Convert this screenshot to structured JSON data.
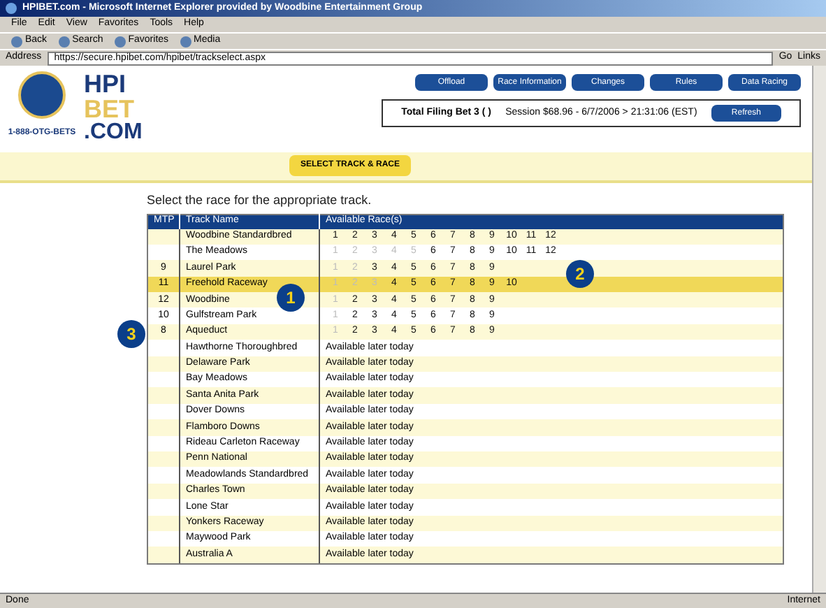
{
  "window": {
    "title": "HPIBET.com - Microsoft Internet Explorer provided by Woodbine Entertainment Group"
  },
  "menu": [
    "File",
    "Edit",
    "View",
    "Favorites",
    "Tools",
    "Help"
  ],
  "toolbar": [
    "Back",
    "Search",
    "Favorites",
    "Media"
  ],
  "address": {
    "label": "Address",
    "value": "https://secure.hpibet.com/hpibet/trackselect.aspx"
  },
  "go": "Go",
  "links": "Links",
  "site": {
    "logo_top": "HPI",
    "logo_mid": "BET",
    "logo_bottom": ".COM",
    "phone": "1-888-OTG-BETS",
    "nav": [
      "Offload",
      "Race Information",
      "Changes",
      "Rules",
      "Data Racing"
    ],
    "info": "Total Filing Bet 3 ( )",
    "session": "Session $68.96 - 6/7/2006 > 21:31:06 (EST)",
    "refresh": "Refresh",
    "tab": "SELECT TRACK & RACE"
  },
  "heading": "Select the race for the appropriate track.",
  "table": {
    "columns": [
      "MTP",
      "Track Name",
      "Available Race(s)"
    ],
    "rows": [
      {
        "kind": "races",
        "mtp": "",
        "track": "Woodbine Standardbred",
        "selected": false,
        "races": [
          {
            "label": "1",
            "enabled": true
          },
          {
            "label": "2",
            "enabled": true
          },
          {
            "label": "3",
            "enabled": true
          },
          {
            "label": "4",
            "enabled": true
          },
          {
            "label": "5",
            "enabled": true
          },
          {
            "label": "6",
            "enabled": true
          },
          {
            "label": "7",
            "enabled": true
          },
          {
            "label": "8",
            "enabled": true
          },
          {
            "label": "9",
            "enabled": true
          },
          {
            "label": "10",
            "enabled": true
          },
          {
            "label": "11",
            "enabled": true
          },
          {
            "label": "12",
            "enabled": true
          }
        ]
      },
      {
        "kind": "races",
        "mtp": "",
        "track": "The Meadows",
        "selected": false,
        "races": [
          {
            "label": "1",
            "enabled": false
          },
          {
            "label": "2",
            "enabled": false
          },
          {
            "label": "3",
            "enabled": false
          },
          {
            "label": "4",
            "enabled": false
          },
          {
            "label": "5",
            "enabled": false
          },
          {
            "label": "6",
            "enabled": true
          },
          {
            "label": "7",
            "enabled": true
          },
          {
            "label": "8",
            "enabled": true
          },
          {
            "label": "9",
            "enabled": true
          },
          {
            "label": "10",
            "enabled": true
          },
          {
            "label": "11",
            "enabled": true
          },
          {
            "label": "12",
            "enabled": true
          }
        ]
      },
      {
        "kind": "races",
        "mtp": "9",
        "track": "Laurel Park",
        "selected": false,
        "races": [
          {
            "label": "1",
            "enabled": false
          },
          {
            "label": "2",
            "enabled": false
          },
          {
            "label": "3",
            "enabled": true
          },
          {
            "label": "4",
            "enabled": true
          },
          {
            "label": "5",
            "enabled": true
          },
          {
            "label": "6",
            "enabled": true
          },
          {
            "label": "7",
            "enabled": true
          },
          {
            "label": "8",
            "enabled": true
          },
          {
            "label": "9",
            "enabled": true
          }
        ]
      },
      {
        "kind": "races",
        "mtp": "11",
        "track": "Freehold Raceway",
        "selected": true,
        "races": [
          {
            "label": "1",
            "enabled": false
          },
          {
            "label": "2",
            "enabled": false
          },
          {
            "label": "3",
            "enabled": false
          },
          {
            "label": "4",
            "enabled": true
          },
          {
            "label": "5",
            "enabled": true
          },
          {
            "label": "6",
            "enabled": true
          },
          {
            "label": "7",
            "enabled": true
          },
          {
            "label": "8",
            "enabled": true
          },
          {
            "label": "9",
            "enabled": true
          },
          {
            "label": "10",
            "enabled": true
          }
        ]
      },
      {
        "kind": "races",
        "mtp": "12",
        "track": "Woodbine",
        "selected": false,
        "races": [
          {
            "label": "1",
            "enabled": false
          },
          {
            "label": "2",
            "enabled": true
          },
          {
            "label": "3",
            "enabled": true
          },
          {
            "label": "4",
            "enabled": true
          },
          {
            "label": "5",
            "enabled": true
          },
          {
            "label": "6",
            "enabled": true
          },
          {
            "label": "7",
            "enabled": true
          },
          {
            "label": "8",
            "enabled": true
          },
          {
            "label": "9",
            "enabled": true
          }
        ]
      },
      {
        "kind": "races",
        "mtp": "10",
        "track": "Gulfstream Park",
        "selected": false,
        "races": [
          {
            "label": "1",
            "enabled": false
          },
          {
            "label": "2",
            "enabled": true
          },
          {
            "label": "3",
            "enabled": true
          },
          {
            "label": "4",
            "enabled": true
          },
          {
            "label": "5",
            "enabled": true
          },
          {
            "label": "6",
            "enabled": true
          },
          {
            "label": "7",
            "enabled": true
          },
          {
            "label": "8",
            "enabled": true
          },
          {
            "label": "9",
            "enabled": true
          }
        ]
      },
      {
        "kind": "races",
        "mtp": "8",
        "track": "Aqueduct",
        "selected": false,
        "races": [
          {
            "label": "1",
            "enabled": false
          },
          {
            "label": "2",
            "enabled": true
          },
          {
            "label": "3",
            "enabled": true
          },
          {
            "label": "4",
            "enabled": true
          },
          {
            "label": "5",
            "enabled": true
          },
          {
            "label": "6",
            "enabled": true
          },
          {
            "label": "7",
            "enabled": true
          },
          {
            "label": "8",
            "enabled": true
          },
          {
            "label": "9",
            "enabled": true
          }
        ]
      },
      {
        "kind": "later",
        "mtp": "",
        "track": "Hawthorne Thoroughbred",
        "selected": false,
        "note": "Available later today"
      },
      {
        "kind": "later",
        "mtp": "",
        "track": "Delaware Park",
        "selected": false,
        "note": "Available later today"
      },
      {
        "kind": "later",
        "mtp": "",
        "track": "Bay Meadows",
        "selected": false,
        "note": "Available later today"
      },
      {
        "kind": "later",
        "mtp": "",
        "track": "Santa Anita Park",
        "selected": false,
        "note": "Available later today"
      },
      {
        "kind": "later",
        "mtp": "",
        "track": "Dover Downs",
        "selected": false,
        "note": "Available later today"
      },
      {
        "kind": "later",
        "mtp": "",
        "track": "Flamboro Downs",
        "selected": false,
        "note": "Available later today"
      },
      {
        "kind": "later",
        "mtp": "",
        "track": "Rideau Carleton Raceway",
        "selected": false,
        "note": "Available later today"
      },
      {
        "kind": "later",
        "mtp": "",
        "track": "Penn National",
        "selected": false,
        "note": "Available later today"
      },
      {
        "kind": "later",
        "mtp": "",
        "track": "Meadowlands Standardbred",
        "selected": false,
        "note": "Available later today"
      },
      {
        "kind": "later",
        "mtp": "",
        "track": "Charles Town",
        "selected": false,
        "note": "Available later today"
      },
      {
        "kind": "later",
        "mtp": "",
        "track": "Lone Star",
        "selected": false,
        "note": "Available later today"
      },
      {
        "kind": "later",
        "mtp": "",
        "track": "Yonkers Raceway",
        "selected": false,
        "note": "Available later today"
      },
      {
        "kind": "later",
        "mtp": "",
        "track": "Maywood Park",
        "selected": false,
        "note": "Available later today"
      },
      {
        "kind": "later",
        "mtp": "",
        "track": "Australia A",
        "selected": false,
        "note": "Available later today"
      }
    ]
  },
  "status_bar": {
    "left": "Done",
    "zone": "Internet"
  },
  "callouts": [
    "1",
    "2",
    "3"
  ]
}
